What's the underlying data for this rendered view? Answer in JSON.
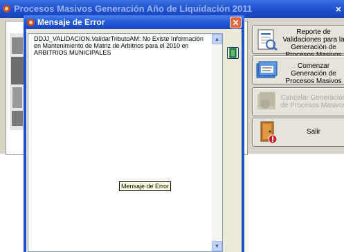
{
  "background_window": {
    "title": "Procesos Masivos Generación Año de Liquidación 2011",
    "buttons": [
      {
        "label": "Reporte de Validaciones para la Generación de Procesos Masivos",
        "icon": "report-icon",
        "enabled": true
      },
      {
        "label": "Comenzar Generación de Procesos Masivos",
        "icon": "folders-icon",
        "enabled": true
      },
      {
        "label": "Cancelar Generación de Procesos Masivos",
        "icon": "cancel-generation-icon",
        "enabled": false
      },
      {
        "label": "Salir",
        "icon": "exit-door-icon",
        "enabled": true
      }
    ]
  },
  "dialog": {
    "title": "Mensaje de Error",
    "message": "DDJJ_VALIDACION.ValidarTributoAM: No Existe Información en Mantenimiento de Matriz de Arbitrios para el 2010 en ARBITRIOS MUNICIPALES",
    "tooltip": "Mensaje de Error"
  },
  "colors": {
    "titlebar": "#1e4fcf",
    "dialog_face": "#ece9d8",
    "close_button": "#e2673f"
  }
}
